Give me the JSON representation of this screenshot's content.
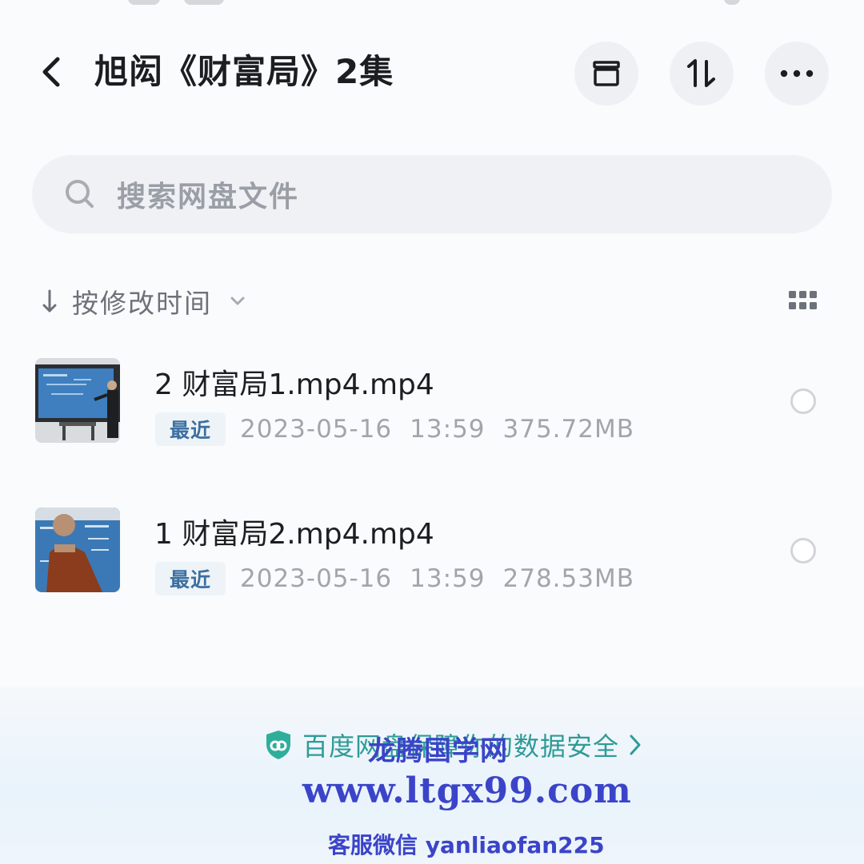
{
  "header": {
    "title": "旭闳《财富局》2集"
  },
  "search": {
    "placeholder": "搜索网盘文件"
  },
  "sort": {
    "label": "按修改时间"
  },
  "files": [
    {
      "name": "2 财富局1.mp4.mp4",
      "badge": "最近",
      "date": "2023-05-16",
      "time": "13:59",
      "size": "375.72MB"
    },
    {
      "name": "1 财富局2.mp4.mp4",
      "badge": "最近",
      "date": "2023-05-16",
      "time": "13:59",
      "size": "278.53MB"
    }
  ],
  "footer": {
    "security_text": "百度网盘保障你的数据安全"
  },
  "watermark": {
    "name": "龙腾国学网",
    "url": "www.ltgx99.com",
    "contact": "客服微信 yanliaofan225"
  },
  "colors": {
    "accent": "#2e9b97",
    "badge_text": "#3c6fa1",
    "watermark": "#3b44c8"
  },
  "icons": {
    "back": "chevron-left-icon",
    "archive": "archive-box-icon",
    "sort": "sort-arrows-icon",
    "more": "more-dots-icon",
    "search": "search-icon",
    "grid": "grid-view-icon",
    "shield": "shield-icon"
  }
}
